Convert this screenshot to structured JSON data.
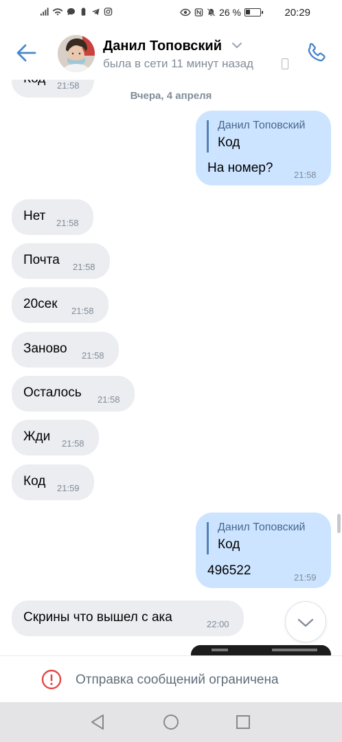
{
  "status_bar": {
    "battery": "26 %",
    "time": "20:29"
  },
  "header": {
    "name": "Данил Топовский",
    "status": "была в сети 11 минут назад"
  },
  "chat": {
    "partial_top": {
      "text": "Код",
      "time": "21:58"
    },
    "date_separator": "Вчера, 4 апреля",
    "outgoing_1": {
      "reply_name": "Данил Топовский",
      "reply_text": "Код",
      "text": "На номер?",
      "time": "21:58"
    },
    "incoming": [
      {
        "text": "Нет",
        "time": "21:58"
      },
      {
        "text": "Почта",
        "time": "21:58"
      },
      {
        "text": "20сек",
        "time": "21:58"
      },
      {
        "text": "Заново",
        "time": "21:58"
      },
      {
        "text": "Осталось",
        "time": "21:58"
      },
      {
        "text": "Жди",
        "time": "21:58"
      },
      {
        "text": "Код",
        "time": "21:59"
      }
    ],
    "outgoing_2": {
      "reply_name": "Данил Топовский",
      "reply_text": "Код",
      "text": "496522",
      "time": "21:59"
    },
    "last_incoming": {
      "text": "Скрины что вышел с ака",
      "time": "22:00"
    }
  },
  "restriction": {
    "text": "Отправка сообщений ограничена"
  },
  "icons": {
    "back": "arrow-left-icon",
    "call": "phone-icon",
    "scroll": "chevron-down-icon",
    "warning": "alert-circle-icon"
  },
  "colors": {
    "accent": "#5181b8",
    "incoming_bubble": "#ebedf0",
    "outgoing_bubble": "#cce4ff",
    "secondary_text": "#818c99",
    "warning": "#e64646"
  }
}
